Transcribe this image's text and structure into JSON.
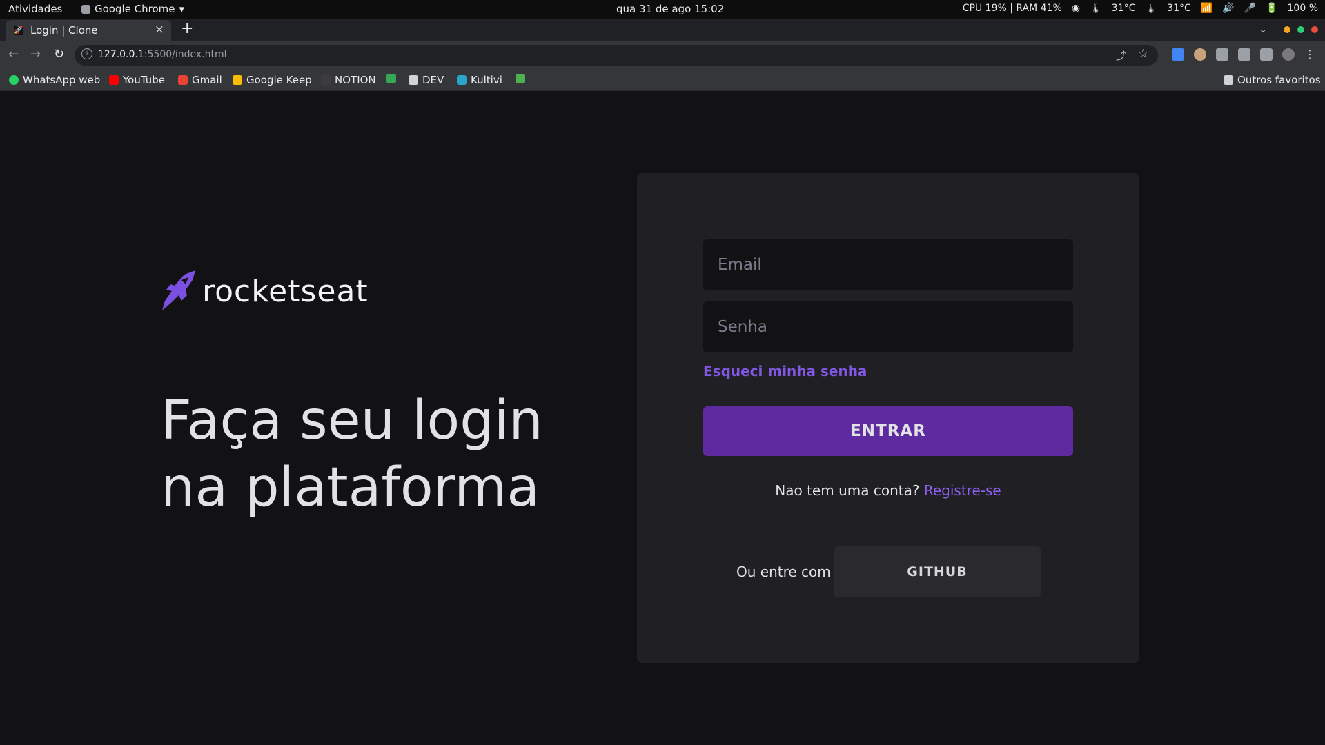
{
  "system_bar": {
    "activities": "Atividades",
    "app_name": "Google Chrome",
    "clock": "qua 31 de ago  15:02",
    "cpu_ram": "CPU  19% | RAM  41%",
    "temp1": "31°C",
    "temp2": "31°C",
    "battery": "100 %"
  },
  "browser": {
    "tab_title": "Login | Clone",
    "tab_favicon": "🚀",
    "url_host": "127.0.0.1",
    "url_rest": ":5500/index.html",
    "bookmarks": [
      {
        "label": "WhatsApp web",
        "icon_color": "#25d366"
      },
      {
        "label": "YouTube",
        "icon_color": "#ff0000"
      },
      {
        "label": "Gmail",
        "icon_color": "#ea4335"
      },
      {
        "label": "Google Keep",
        "icon_color": "#fbbc04"
      },
      {
        "label": "NOTION",
        "icon_color": "#3c3c3c"
      },
      {
        "label": "",
        "icon_color": "#34a853"
      },
      {
        "label": "DEV",
        "icon_color": "#cfd2d6"
      },
      {
        "label": "Kultivi",
        "icon_color": "#2aa6c9"
      },
      {
        "label": "",
        "icon_color": "#4caf50"
      }
    ],
    "other_bookmarks": "Outros favoritos"
  },
  "page": {
    "logo_text": "rocketseat",
    "headline_line1": "Faça seu login",
    "headline_line2": "na plataforma",
    "email_placeholder": "Email",
    "password_placeholder": "Senha",
    "forgot_password": "Esqueci minha senha",
    "submit_label": "ENTRAR",
    "register_prompt": "Nao tem uma conta?",
    "register_link": "Registre-se",
    "or_login_with": "Ou entre com",
    "github_label": "GITHUB"
  },
  "colors": {
    "background": "#121214",
    "card": "#202024",
    "accent": "#8257e5",
    "button": "#5d2aa0"
  }
}
